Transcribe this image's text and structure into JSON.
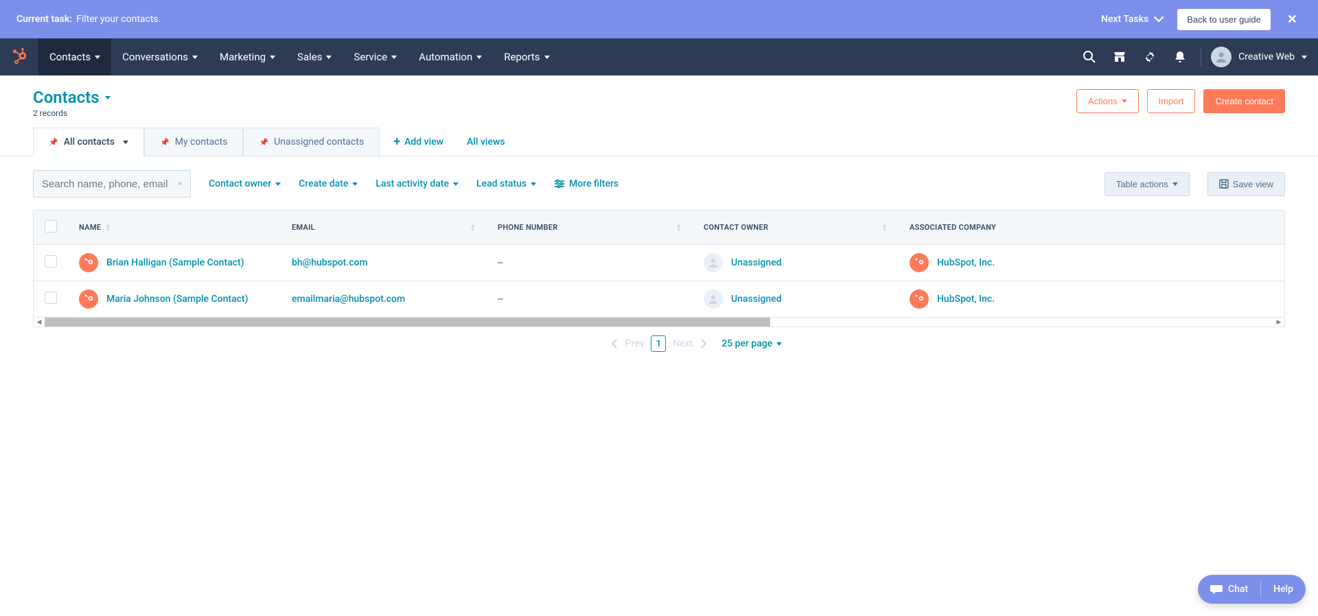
{
  "taskbar": {
    "label": "Current task:",
    "task": "Filter your contacts.",
    "next_tasks": "Next Tasks",
    "back_to_guide": "Back to user guide"
  },
  "nav": {
    "items": [
      "Contacts",
      "Conversations",
      "Marketing",
      "Sales",
      "Service",
      "Automation",
      "Reports"
    ],
    "account_name": "Creative Web"
  },
  "header": {
    "title": "Contacts",
    "records": "2 records",
    "actions": "Actions",
    "import": "Import",
    "create": "Create contact"
  },
  "tabs": {
    "items": [
      "All contacts",
      "My contacts",
      "Unassigned contacts"
    ],
    "add_view": "Add view",
    "all_views": "All views"
  },
  "filters": {
    "search_placeholder": "Search name, phone, email",
    "contact_owner": "Contact owner",
    "create_date": "Create date",
    "last_activity": "Last activity date",
    "lead_status": "Lead status",
    "more_filters": "More filters",
    "table_actions": "Table actions",
    "save_view": "Save view"
  },
  "table": {
    "columns": [
      "NAME",
      "EMAIL",
      "PHONE NUMBER",
      "CONTACT OWNER",
      "ASSOCIATED COMPANY"
    ],
    "rows": [
      {
        "name": "Brian Halligan (Sample Contact)",
        "email": "bh@hubspot.com",
        "phone": "--",
        "owner": "Unassigned",
        "company": "HubSpot, Inc."
      },
      {
        "name": "Maria Johnson (Sample Contact)",
        "email": "emailmaria@hubspot.com",
        "phone": "--",
        "owner": "Unassigned",
        "company": "HubSpot, Inc."
      }
    ]
  },
  "pagination": {
    "prev": "Prev",
    "page": "1",
    "next": "Next",
    "per_page": "25 per page"
  },
  "help": {
    "chat": "Chat",
    "help": "Help"
  }
}
